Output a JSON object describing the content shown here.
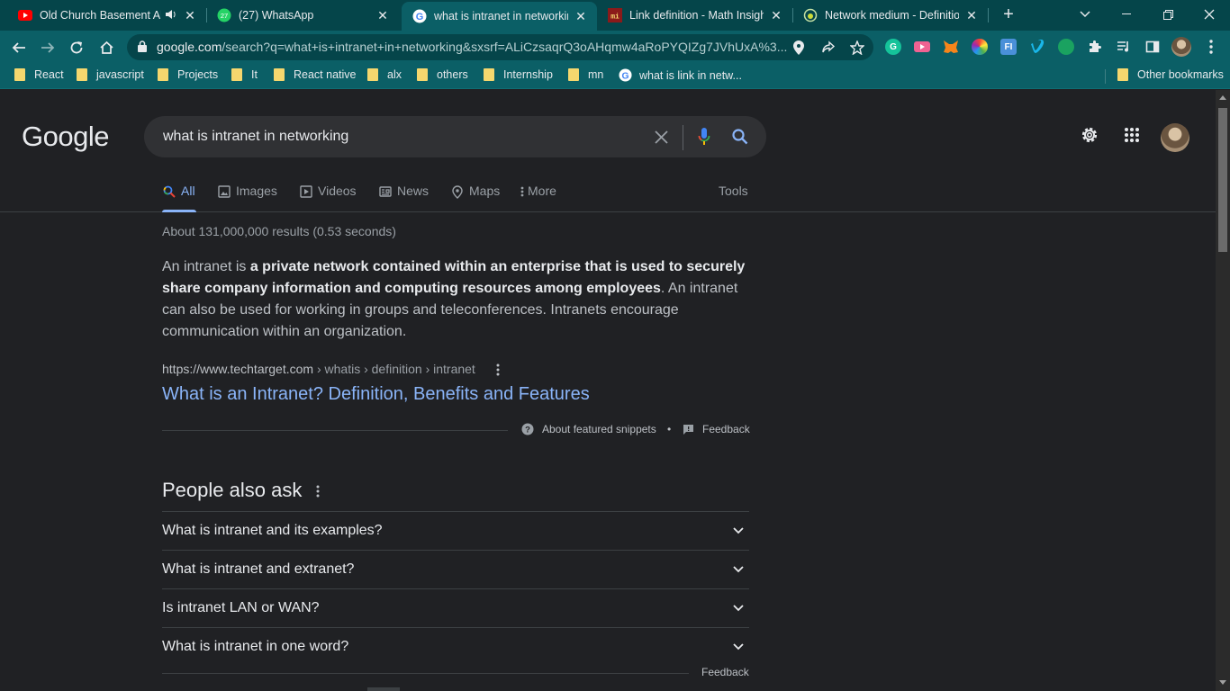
{
  "browser": {
    "tabs": [
      {
        "title": "Old Church Basement Al",
        "icon": "youtube-icon",
        "audio": true
      },
      {
        "title": "(27) WhatsApp",
        "icon": "whatsapp-icon",
        "badge": "27"
      },
      {
        "title": "what is intranet in networking",
        "icon": "google-icon",
        "active": true
      },
      {
        "title": "Link definition - Math Insight",
        "icon": "math-insight-icon",
        "badge": "mi"
      },
      {
        "title": "Network medium - Definitior",
        "icon": "globe-icon"
      }
    ],
    "url_host": "google.com",
    "url_rest": "/search?q=what+is+intranet+in+networking&sxsrf=ALiCzsaqrQ3oAHqmw4aRoPYQIZg7JVhUxA%3...",
    "bookmarks": [
      "React",
      "javascript",
      "Projects",
      "It",
      "React native",
      "alx",
      "others",
      "Internship",
      "mn"
    ],
    "google_bookmark": "what is link in netw...",
    "other_bookmarks": "Other bookmarks"
  },
  "header": {
    "logo": "Google",
    "query": "what is intranet in networking"
  },
  "search_tabs": [
    {
      "label": "All",
      "icon": "search-icon",
      "active": true
    },
    {
      "label": "Images",
      "icon": "image-icon"
    },
    {
      "label": "Videos",
      "icon": "video-icon"
    },
    {
      "label": "News",
      "icon": "news-icon"
    },
    {
      "label": "Maps",
      "icon": "map-pin-icon"
    },
    {
      "label": "More",
      "icon": "more-vert-icon"
    }
  ],
  "tools_label": "Tools",
  "result_stats": "About 131,000,000 results (0.53 seconds)",
  "featured_snippet": {
    "text_before": "An intranet is ",
    "text_bold": "a private network contained within an enterprise that is used to securely share company information and computing resources among employees",
    "text_after": ". An intranet can also be used for working in groups and teleconferences. Intranets encourage communication within an organization.",
    "cite_host": "https://www.techtarget.com",
    "cite_path": " › whatis › definition › intranet",
    "link_title": "What is an Intranet? Definition, Benefits and Features",
    "about_label": "About featured snippets",
    "separator": "•",
    "feedback_label": "Feedback"
  },
  "people_also_ask": {
    "title": "People also ask",
    "questions": [
      "What is intranet and its examples?",
      "What is intranet and extranet?",
      "Is intranet LAN or WAN?",
      "What is intranet in one word?"
    ],
    "feedback_label": "Feedback"
  },
  "colors": {
    "page_bg": "#202124",
    "chrome_dark": "#05454a",
    "chrome_light": "#0b5f66",
    "link": "#8ab4f8"
  }
}
